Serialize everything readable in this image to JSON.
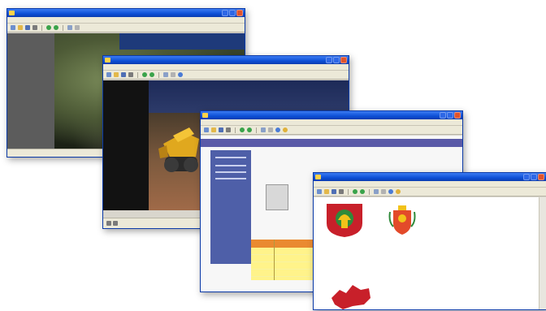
{
  "windows": [
    {
      "id": "w1",
      "title": "",
      "menus": [
        "",
        "",
        "",
        "",
        ""
      ],
      "status": ""
    },
    {
      "id": "w2",
      "title": "",
      "menus": [
        "",
        "",
        "",
        "",
        ""
      ],
      "status": ""
    },
    {
      "id": "w3",
      "title": "",
      "menus": [
        "",
        "",
        "",
        "",
        ""
      ],
      "document": {
        "heading_left": "",
        "heading_right": ""
      },
      "status": ""
    },
    {
      "id": "w4",
      "title": "",
      "menus": [
        "",
        "",
        "",
        "",
        ""
      ],
      "document": {
        "caption": "",
        "item1": "",
        "item2": ""
      }
    }
  ],
  "colors": {
    "titlebar": "#0d4fd6",
    "window_frame": "#0b3aa8",
    "chrome": "#ece9d8",
    "selection_bar": "#5a5aa8",
    "sidebar_blue": "#4e5fa8",
    "emblem_red": "#c8202a",
    "emblem_green": "#2f8a3a",
    "emblem_yellow": "#f2c21a"
  },
  "icons": [
    "new-icon",
    "open-icon",
    "save-icon",
    "print-icon",
    "back-icon",
    "forward-icon",
    "zoom-icon",
    "rotate-icon",
    "info-icon",
    "help-icon"
  ]
}
